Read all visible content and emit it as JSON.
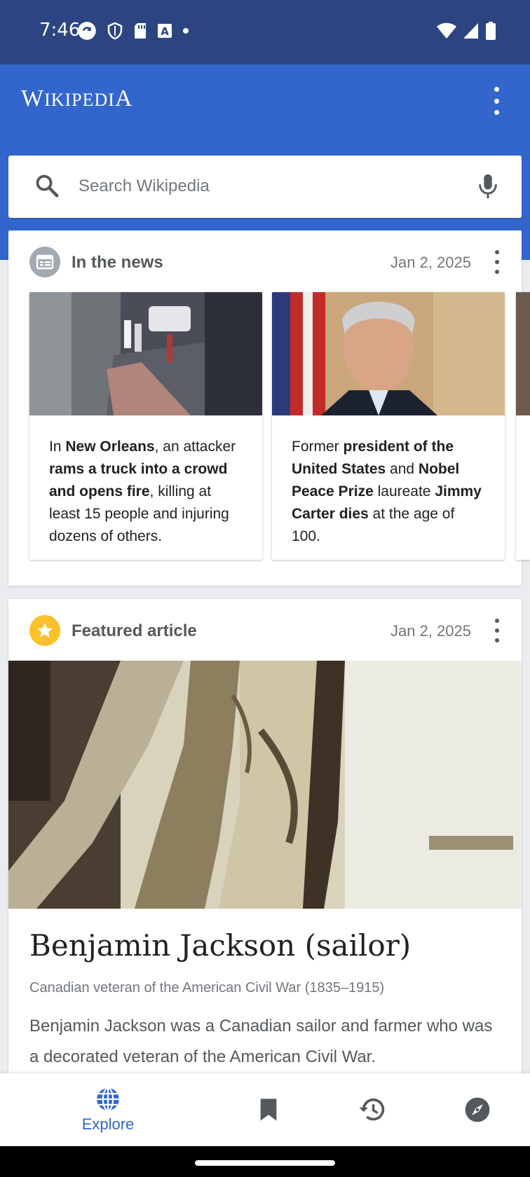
{
  "status": {
    "time": "7:46"
  },
  "app": {
    "title_first": "W",
    "title_rest": "IKIPEDI",
    "title_last": "A"
  },
  "search": {
    "placeholder": "Search Wikipedia"
  },
  "news": {
    "title": "In the news",
    "date": "Jan 2, 2025",
    "items": [
      {
        "parts": [
          {
            "t": "In ",
            "b": false
          },
          {
            "t": "New Orleans",
            "b": true
          },
          {
            "t": ", an attacker ",
            "b": false
          },
          {
            "t": "rams a truck into a crowd and opens fire",
            "b": true
          },
          {
            "t": ", killing at least 15 people and injuring dozens of others.",
            "b": false
          }
        ]
      },
      {
        "parts": [
          {
            "t": "Former ",
            "b": false
          },
          {
            "t": "president of the United States",
            "b": true
          },
          {
            "t": " and ",
            "b": false
          },
          {
            "t": "Nobel Peace Prize",
            "b": true
          },
          {
            "t": " laureate ",
            "b": false
          },
          {
            "t": "Jimmy Carter dies",
            "b": true
          },
          {
            "t": " at the age of 100.",
            "b": false
          }
        ]
      }
    ]
  },
  "featured": {
    "title": "Featured article",
    "date": "Jan 2, 2025",
    "article_title": "Benjamin Jackson (sailor)",
    "description": "Canadian veteran of the American Civil War (1835–1915)",
    "extract": "Benjamin Jackson was a Canadian sailor and farmer who was a decorated veteran of the American Civil War."
  },
  "nav": {
    "explore_label": "Explore",
    "items": [
      "explore",
      "saved",
      "history",
      "nearby"
    ]
  },
  "colors": {
    "brand": "#3366cc",
    "status_bar": "#2c4582",
    "featured_star": "#fcc02b"
  }
}
